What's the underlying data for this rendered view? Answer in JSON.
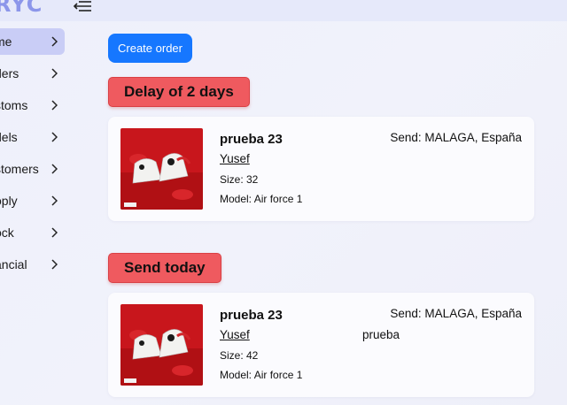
{
  "app": {
    "brand": "RYC"
  },
  "sidebar": {
    "items": [
      {
        "label": "me",
        "active": true
      },
      {
        "label": "ders"
      },
      {
        "label": "stoms"
      },
      {
        "label": "dels"
      },
      {
        "label": "stomers"
      },
      {
        "label": "oply"
      },
      {
        "label": "ock"
      },
      {
        "label": "ancial"
      }
    ]
  },
  "toolbar": {
    "create_order_label": "Create order"
  },
  "sections": [
    {
      "badge": "Delay of 2 days",
      "order": {
        "title": "prueba 23",
        "customer": "Yusef",
        "size": "Size: 32",
        "model": "Model: Air force 1",
        "send": "Send: MALAGA, España",
        "note": ""
      }
    },
    {
      "badge": "Send today",
      "order": {
        "title": "prueba 23",
        "customer": "Yusef",
        "size": "Size: 42",
        "model": "Model: Air force 1",
        "send": "Send: MALAGA, España",
        "note": "prueba"
      }
    }
  ],
  "colors": {
    "primary": "#1677ff",
    "badge": "#ef5a5f",
    "sidebar_active": "#c9cdf6",
    "brand": "#8c96ea"
  },
  "icons": {
    "menu_toggle": "menu-collapse-icon",
    "chevron": "chevron-right-icon",
    "product": "sneaker-photo"
  }
}
